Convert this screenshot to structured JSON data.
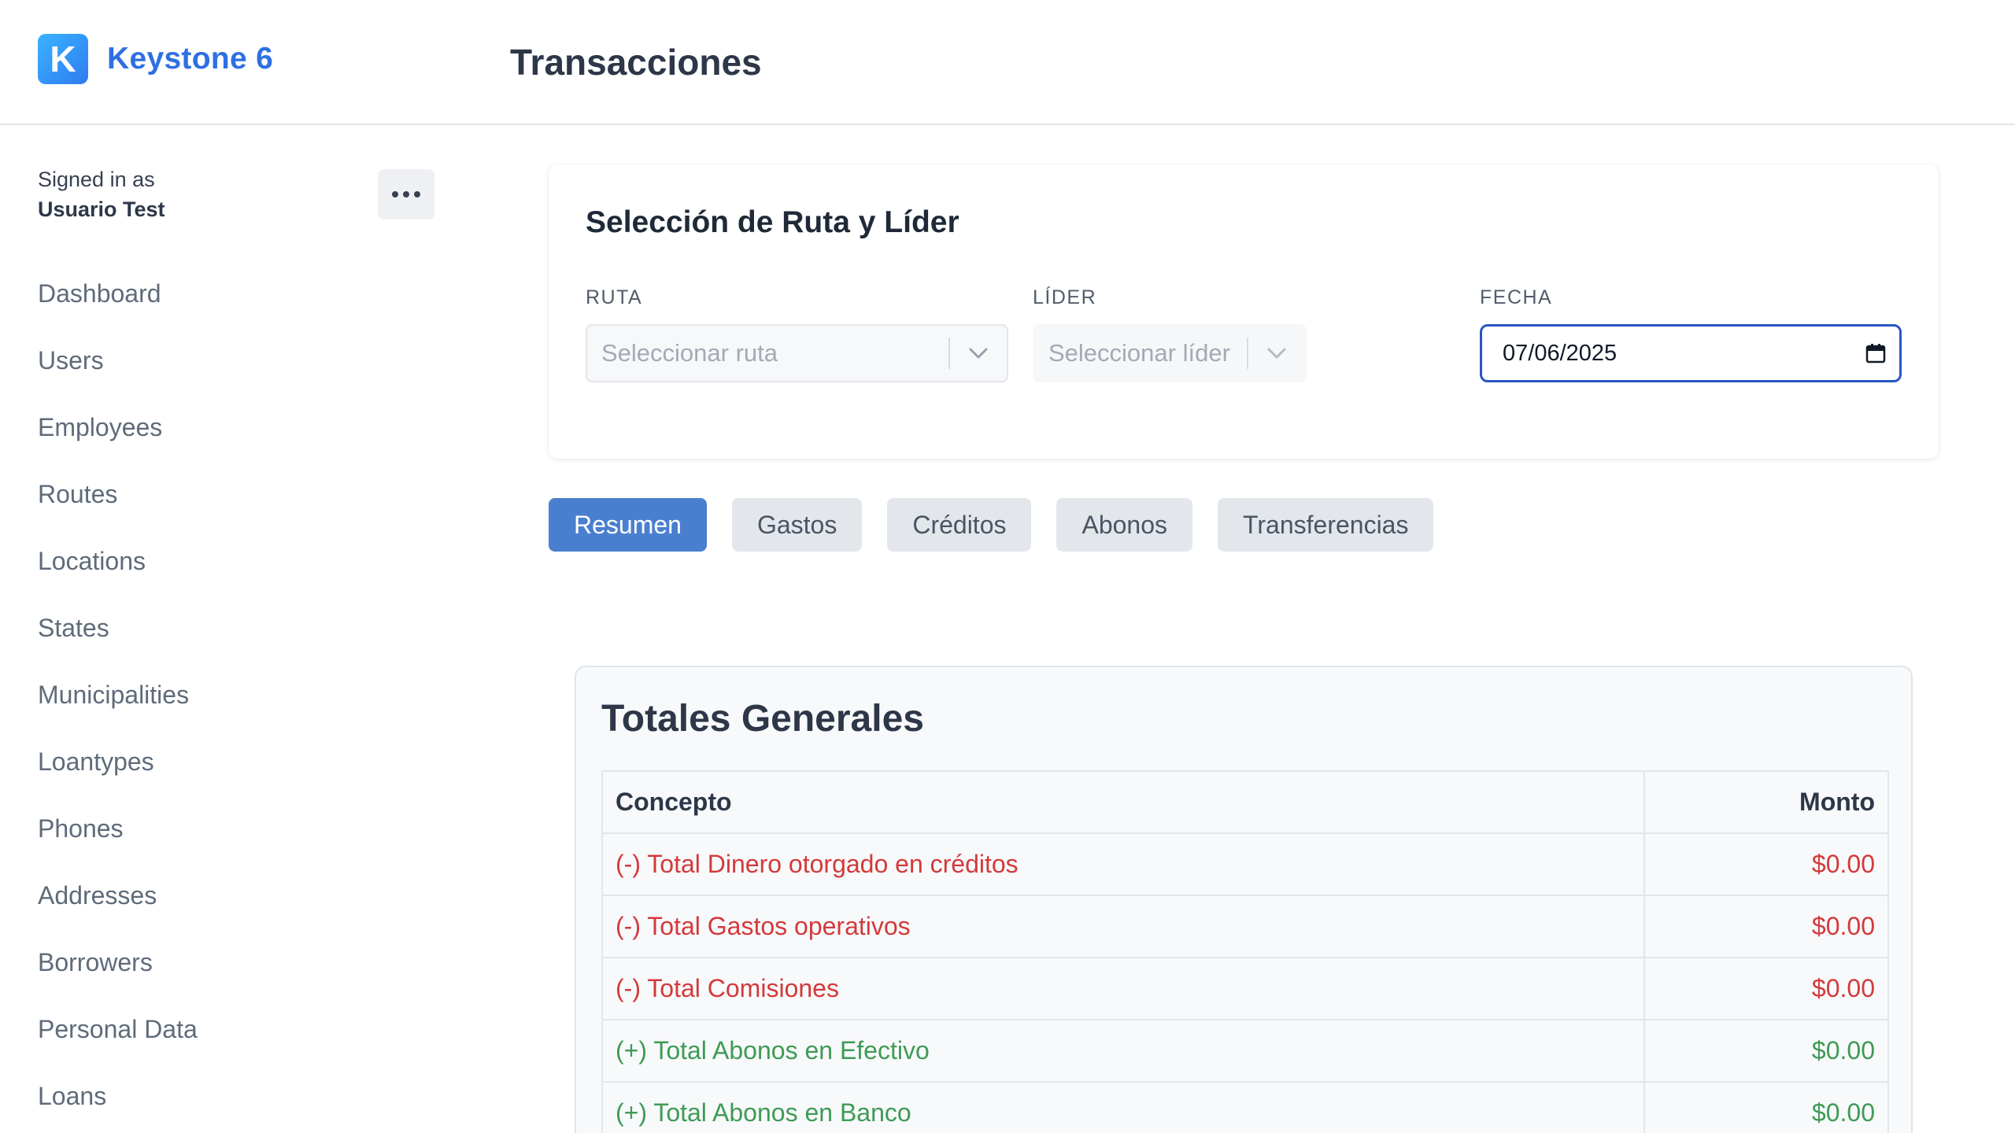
{
  "header": {
    "logo_letter": "K",
    "app_name": "Keystone 6",
    "page_title": "Transacciones"
  },
  "sidebar": {
    "signed_in_label": "Signed in as",
    "user_name": "Usuario Test",
    "items": [
      {
        "label": "Dashboard"
      },
      {
        "label": "Users"
      },
      {
        "label": "Employees"
      },
      {
        "label": "Routes"
      },
      {
        "label": "Locations"
      },
      {
        "label": "States"
      },
      {
        "label": "Municipalities"
      },
      {
        "label": "Loantypes"
      },
      {
        "label": "Phones"
      },
      {
        "label": "Addresses"
      },
      {
        "label": "Borrowers"
      },
      {
        "label": "Personal Data"
      },
      {
        "label": "Loans"
      }
    ]
  },
  "selection": {
    "title": "Selección de Ruta y Líder",
    "route_label": "RUTA",
    "route_placeholder": "Seleccionar ruta",
    "leader_label": "LÍDER",
    "leader_placeholder": "Seleccionar líder",
    "date_label": "FECHA",
    "date_value": "07/06/2025"
  },
  "tabs": [
    {
      "label": "Resumen",
      "active": true
    },
    {
      "label": "Gastos",
      "active": false
    },
    {
      "label": "Créditos",
      "active": false
    },
    {
      "label": "Abonos",
      "active": false
    },
    {
      "label": "Transferencias",
      "active": false
    }
  ],
  "totals": {
    "title": "Totales Generales",
    "headers": {
      "concept": "Concepto",
      "amount": "Monto"
    },
    "rows": [
      {
        "concept": "(-) Total Dinero otorgado en créditos",
        "amount": "$0.00",
        "type": "negative"
      },
      {
        "concept": "(-) Total Gastos operativos",
        "amount": "$0.00",
        "type": "negative"
      },
      {
        "concept": "(-) Total Comisiones",
        "amount": "$0.00",
        "type": "negative"
      },
      {
        "concept": "(+) Total Abonos en Efectivo",
        "amount": "$0.00",
        "type": "positive"
      },
      {
        "concept": "(+) Total Abonos en Banco",
        "amount": "$0.00",
        "type": "positive"
      }
    ]
  },
  "colors": {
    "brand": "#2f6fe4",
    "active_tab": "#4a7fd0",
    "negative": "#d33a3a",
    "positive": "#3e9b55"
  },
  "icons": [
    "keystone-logo",
    "more-icon",
    "chevron-down-icon",
    "calendar-icon"
  ]
}
